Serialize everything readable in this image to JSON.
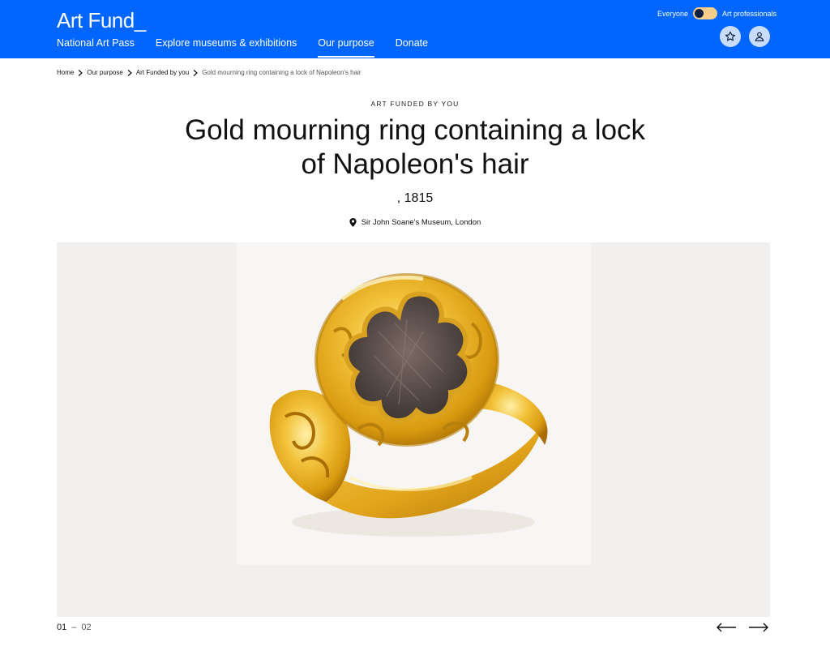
{
  "header": {
    "logo": "Art Fund_",
    "nav": [
      {
        "label": "National Art Pass"
      },
      {
        "label": "Explore museums & exhibitions"
      },
      {
        "label": "Our purpose"
      },
      {
        "label": "Donate"
      }
    ],
    "active_nav": "Our purpose",
    "audience": {
      "left_label": "Everyone",
      "right_label": "Art professionals"
    },
    "favourites_icon": "star-icon",
    "account_icon": "user-icon"
  },
  "breadcrumb": {
    "items": [
      "Home",
      "Our purpose",
      "Art Funded by you"
    ],
    "current": "Gold mourning ring containing a lock of Napoleon's hair"
  },
  "artwork": {
    "kicker": "ART FUNDED BY YOU",
    "title": "Gold mourning ring containing a lock of Napoleon's hair",
    "date": ", 1815",
    "location": "Sir John Soane's Museum, London",
    "location_icon": "map-pin-icon"
  },
  "gallery": {
    "current_index": "01",
    "separator": "–",
    "total": "02",
    "prev_icon": "arrow-left-icon",
    "next_icon": "arrow-right-icon"
  },
  "colors": {
    "brand_blue": "#0066ff",
    "toggle_yellow": "#f6cd8a",
    "gold": "#e0a91f"
  }
}
